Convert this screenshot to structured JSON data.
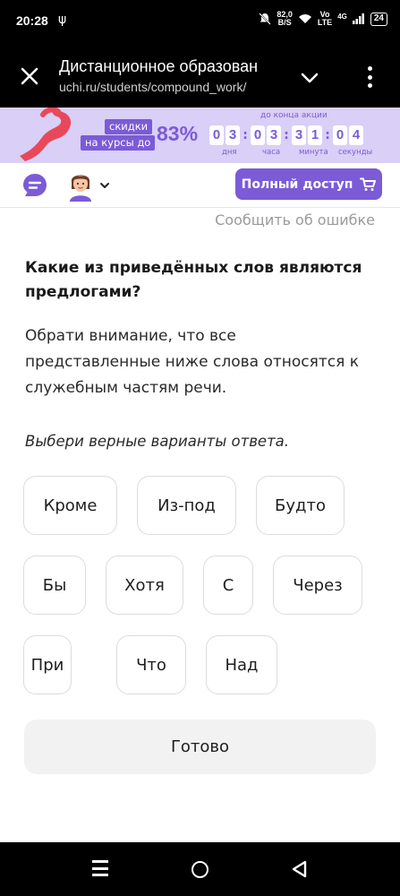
{
  "status_bar": {
    "time": "20:28",
    "usb_symbol": "ψ",
    "speed_value": "82,0",
    "speed_unit": "B/S",
    "volte_line1": "Vo",
    "volte_line2": "LTE",
    "network": "4G",
    "battery": "24"
  },
  "browser": {
    "title": "Дистанционное образован",
    "url": "uchi.ru/students/compound_work/"
  },
  "promo": {
    "label_line1": "скидки",
    "label_line2": "на курсы до",
    "percent": "83%",
    "until": "до конца акции",
    "days": [
      "0",
      "3"
    ],
    "hours": [
      "0",
      "3"
    ],
    "minutes": [
      "3",
      "1"
    ],
    "seconds": [
      "0",
      "4"
    ],
    "days_label": "дня",
    "hours_label": "часа",
    "minutes_label": "минута",
    "seconds_label": "секунды",
    "accent_color": "#7b5bd6"
  },
  "app_header": {
    "full_access_label": "Полный доступ"
  },
  "content": {
    "report_error": "Сообщить об ошибке",
    "question": "Какие из приведённых слов являются предлогами?",
    "hint": "Обрати внимание, что все представленные ниже слова относятся к служебным частям речи.",
    "instruction": "Выбери верные варианты ответа.",
    "options": [
      [
        "Кроме",
        "Из-под",
        "Будто"
      ],
      [
        "Бы",
        "Хотя",
        "С",
        "Через"
      ],
      [
        "При",
        "Что",
        "Над"
      ]
    ],
    "done_label": "Готово"
  },
  "nav_bar": {
    "recent_icon": "menu-icon",
    "home_icon": "circle-icon",
    "back_icon": "triangle-back-icon"
  }
}
